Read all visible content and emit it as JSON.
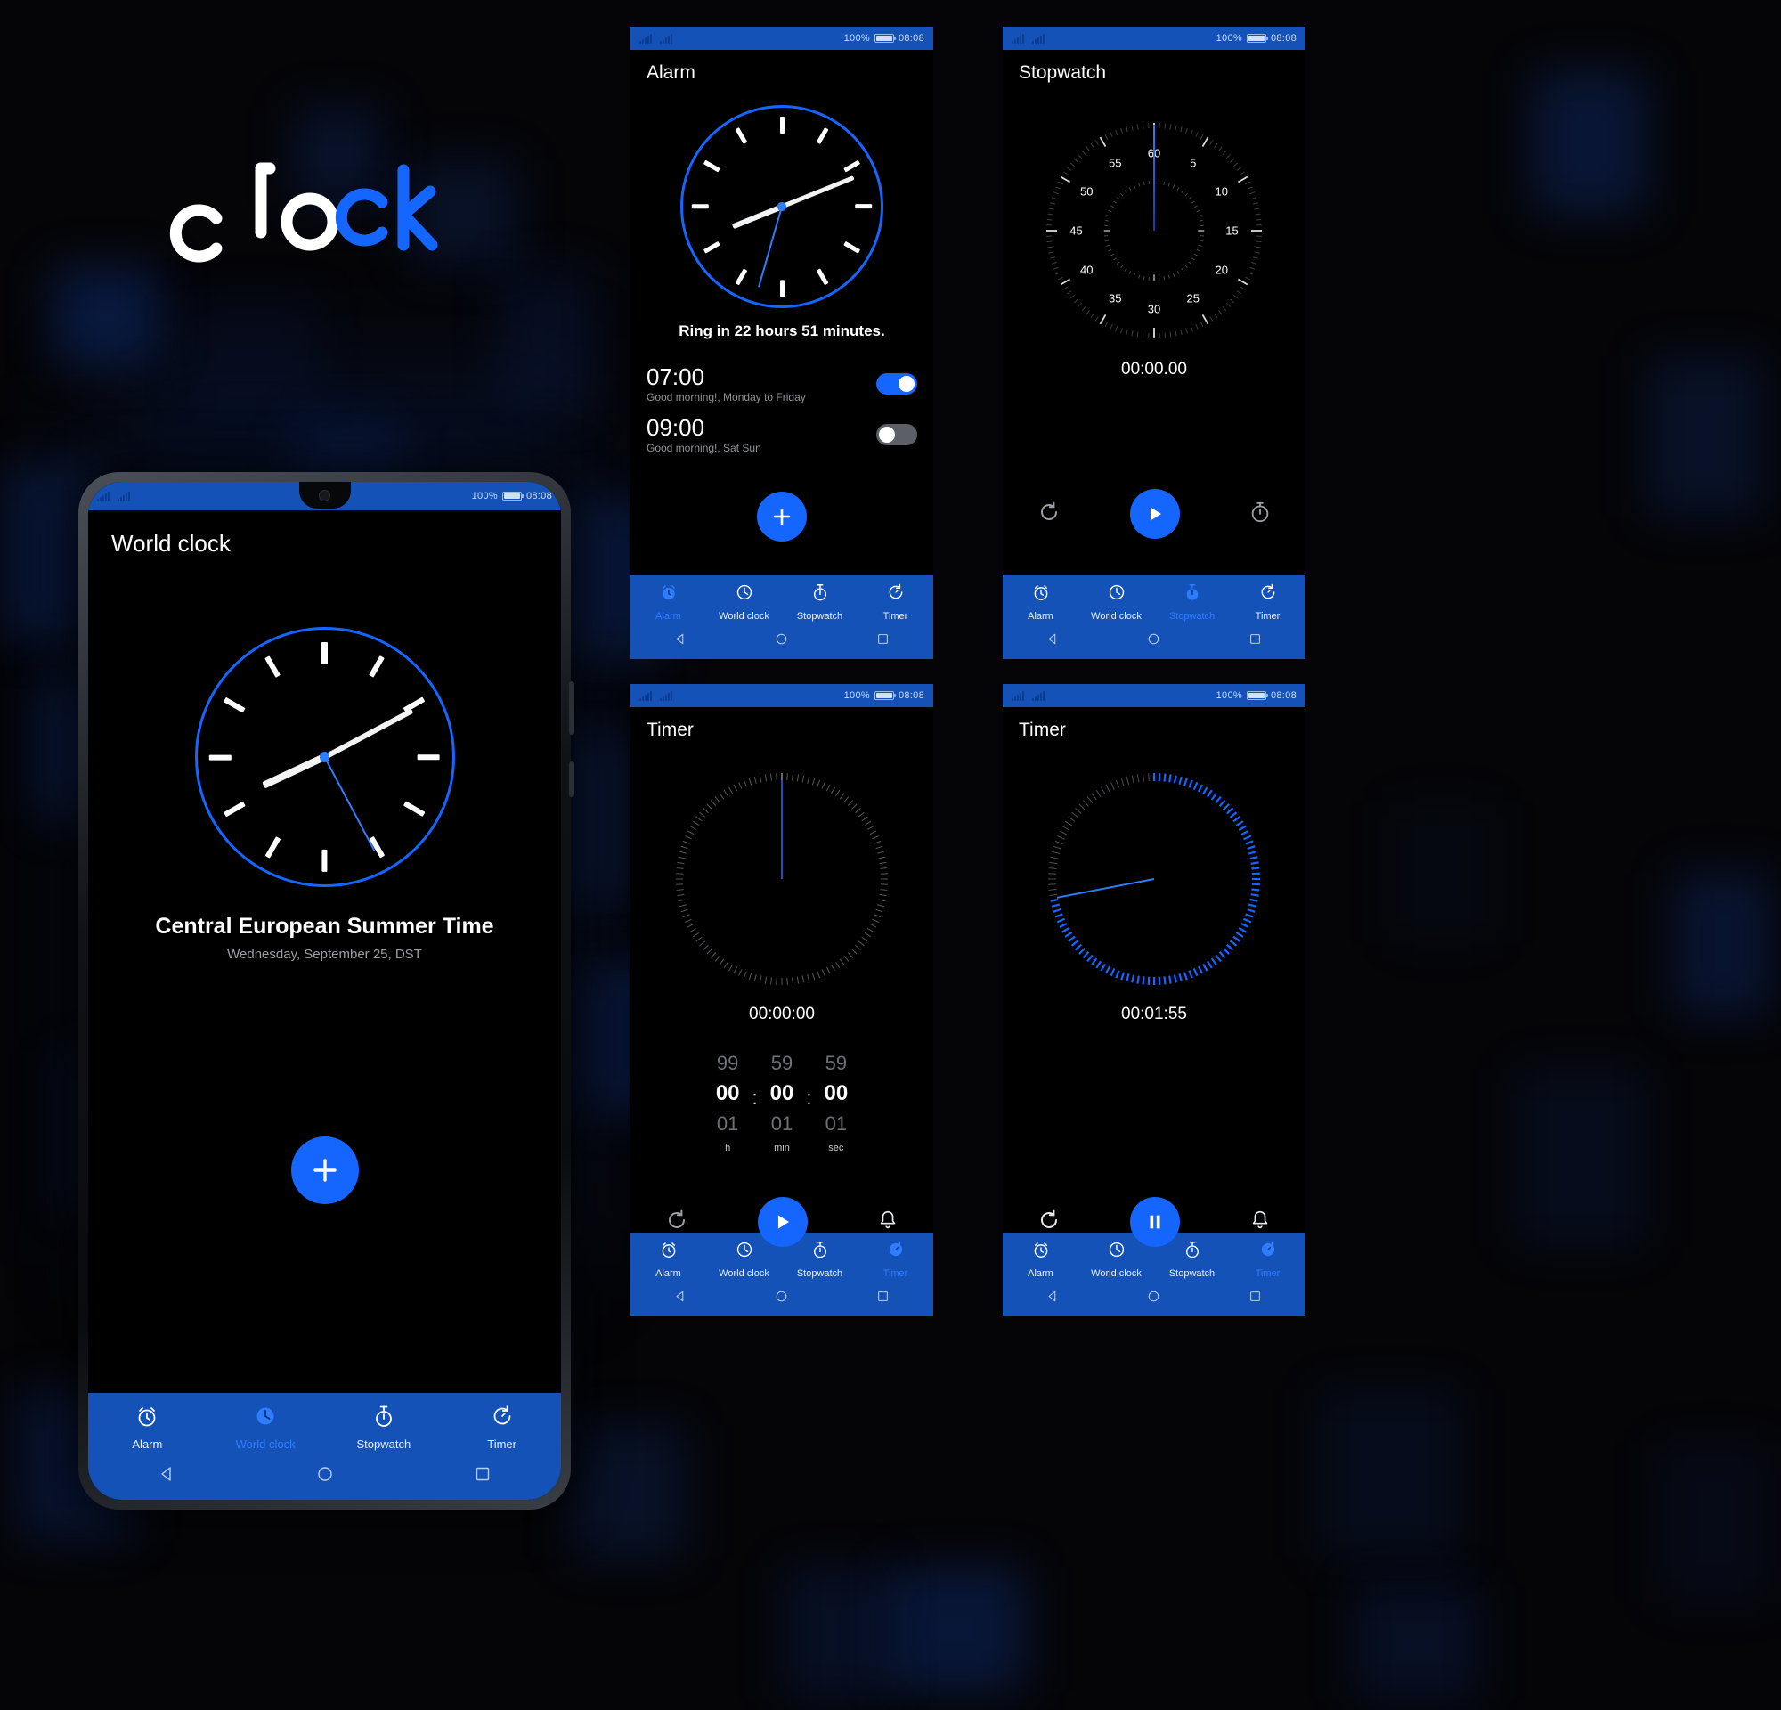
{
  "app": {
    "logo_text": "clock",
    "logo_white_part": "clo",
    "logo_blue_part": "ck",
    "accent": "#1565ff",
    "navbar_bg": "#1452b8",
    "screen_bg": "#000000"
  },
  "status_bar": {
    "battery_percent": "100%",
    "time": "08:08",
    "signal_icon": "signal-bars-icon",
    "battery_icon": "battery-icon"
  },
  "nav": {
    "tabs": [
      {
        "label": "Alarm",
        "icon": "alarm-clock-icon"
      },
      {
        "label": "World clock",
        "icon": "clock-icon"
      },
      {
        "label": "Stopwatch",
        "icon": "stopwatch-icon"
      },
      {
        "label": "Timer",
        "icon": "timer-icon"
      }
    ],
    "system": [
      {
        "name": "back-button",
        "icon": "triangle-back-icon"
      },
      {
        "name": "home-button",
        "icon": "circle-home-icon"
      },
      {
        "name": "recents-button",
        "icon": "square-recents-icon"
      }
    ]
  },
  "screens": {
    "world_clock": {
      "title": "World clock",
      "active_tab": "World clock",
      "timezone_name": "Central European Summer Time",
      "date_line": "Wednesday, September 25, DST",
      "add_button": "+",
      "clock": {
        "hour_angle": 245,
        "minute_angle": 62,
        "second_angle": 152
      }
    },
    "alarm": {
      "title": "Alarm",
      "active_tab": "Alarm",
      "ring_status": "Ring in 22 hours 51 minutes.",
      "add_button": "+",
      "clock": {
        "hour_angle": 248,
        "minute_angle": 68,
        "second_angle": 196
      },
      "alarms": [
        {
          "time": "07:00",
          "label": "Good morning!, Monday to Friday",
          "enabled": true
        },
        {
          "time": "09:00",
          "label": "Good morning!, Sat Sun",
          "enabled": false
        }
      ]
    },
    "stopwatch": {
      "title": "Stopwatch",
      "active_tab": "Stopwatch",
      "elapsed": "00:00.00",
      "dial_numbers": [
        "60",
        "5",
        "10",
        "15",
        "20",
        "25",
        "30",
        "35",
        "40",
        "45",
        "50",
        "55"
      ],
      "controls": [
        {
          "name": "reset-button",
          "icon": "reset-arrow-icon"
        },
        {
          "name": "start-button",
          "icon": "play-icon"
        },
        {
          "name": "lap-button",
          "icon": "stopwatch-icon"
        }
      ]
    },
    "timer_idle": {
      "title": "Timer",
      "active_tab": "Timer",
      "elapsed": "00:00:00",
      "picker": {
        "hours": {
          "above": "99",
          "selected": "00",
          "below": "01",
          "unit": "h"
        },
        "minutes": {
          "above": "59",
          "selected": "00",
          "below": "01",
          "unit": "min"
        },
        "seconds": {
          "above": "59",
          "selected": "00",
          "below": "01",
          "unit": "sec"
        },
        "separator": ":"
      },
      "controls": [
        {
          "name": "reset-button",
          "icon": "reset-arrow-icon"
        },
        {
          "name": "start-button",
          "icon": "play-icon"
        },
        {
          "name": "ringtone-button",
          "icon": "bell-icon"
        }
      ]
    },
    "timer_running": {
      "title": "Timer",
      "active_tab": "Timer",
      "elapsed": "00:01:55",
      "progress_percent": 72,
      "controls": [
        {
          "name": "reset-button",
          "icon": "reset-arrow-icon"
        },
        {
          "name": "pause-button",
          "icon": "pause-icon"
        },
        {
          "name": "ringtone-button",
          "icon": "bell-icon"
        }
      ]
    }
  }
}
